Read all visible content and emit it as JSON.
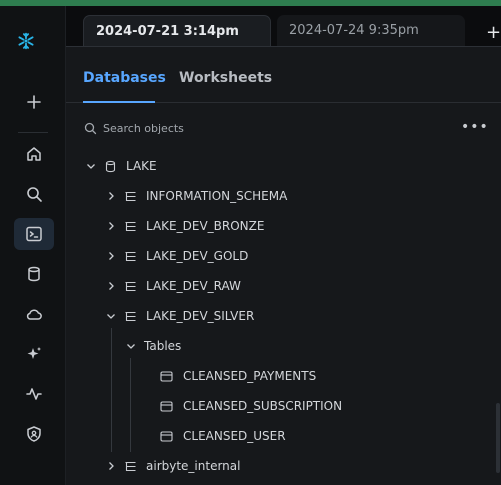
{
  "rail": {
    "icons": [
      "snowflake-logo-icon",
      "plus-icon",
      "home-icon",
      "search-icon",
      "worksheet-icon",
      "database-icon",
      "cloud-icon",
      "sparkle-icon",
      "activity-icon",
      "shield-icon"
    ]
  },
  "doc_tabs": [
    {
      "label": "2024-07-21 3:14pm",
      "active": true
    },
    {
      "label": "2024-07-24 9:35pm",
      "active": false
    }
  ],
  "panel_tabs": [
    {
      "label": "Databases",
      "active": true
    },
    {
      "label": "Worksheets",
      "active": false
    }
  ],
  "search": {
    "placeholder": "Search objects",
    "value": ""
  },
  "tree": {
    "database": "LAKE",
    "schemas": [
      {
        "name": "INFORMATION_SCHEMA",
        "expanded": false
      },
      {
        "name": "LAKE_DEV_BRONZE",
        "expanded": false
      },
      {
        "name": "LAKE_DEV_GOLD",
        "expanded": false
      },
      {
        "name": "LAKE_DEV_RAW",
        "expanded": false
      },
      {
        "name": "LAKE_DEV_SILVER",
        "expanded": true
      }
    ],
    "tables_group": "Tables",
    "tables": [
      "CLEANSED_PAYMENTS",
      "CLEANSED_SUBSCRIPTION",
      "CLEANSED_USER"
    ],
    "after_schema": {
      "name": "airbyte_internal",
      "expanded": false
    }
  },
  "colors": {
    "accent": "#58a6ff",
    "logo": "#29b5e8"
  }
}
